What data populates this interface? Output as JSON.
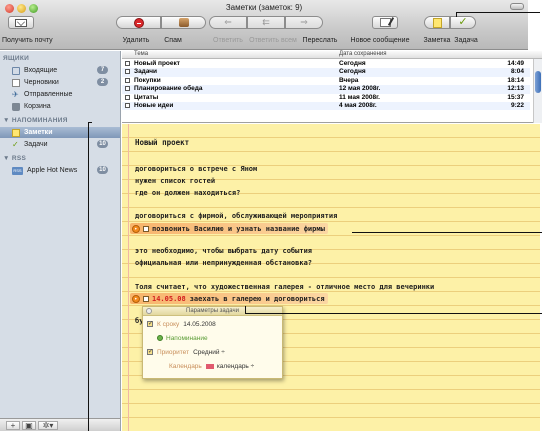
{
  "window": {
    "title": "Заметки (заметок: 9)"
  },
  "toolbar": {
    "get_mail": "Получить почту",
    "delete": "Удалить",
    "junk": "Спам",
    "reply": "Ответить",
    "reply_all": "Ответить всем",
    "forward": "Переслать",
    "new_message": "Новое сообщение",
    "note": "Заметка",
    "task": "Задача"
  },
  "sidebar": {
    "mailboxes_header": "ЯЩИКИ",
    "mailboxes": [
      {
        "label": "Входящие",
        "badge": "7",
        "icon": "inbox-icon"
      },
      {
        "label": "Черновики",
        "badge": "2",
        "icon": "drafts-icon"
      },
      {
        "label": "Отправленные",
        "badge": "",
        "icon": "sent-icon"
      },
      {
        "label": "Корзина",
        "badge": "",
        "icon": "trash-icon"
      }
    ],
    "reminders_header": "▼ НАПОМИНАНИЯ",
    "reminders": [
      {
        "label": "Заметки",
        "badge": "",
        "icon": "notes-icon",
        "selected": true
      },
      {
        "label": "Задачи",
        "badge": "10",
        "icon": "tasks-icon",
        "selected": false
      }
    ],
    "rss_header": "▼ RSS",
    "rss": [
      {
        "label": "Apple Hot News",
        "badge": "10",
        "icon": "rss-icon"
      }
    ]
  },
  "message_list": {
    "columns": {
      "subject": "Тема",
      "date": "Дата сохранения"
    },
    "rows": [
      {
        "subject": "Новый проект",
        "date": "Сегодня",
        "time": "14:49"
      },
      {
        "subject": "Задачи",
        "date": "Сегодня",
        "time": "8:04"
      },
      {
        "subject": "Покупки",
        "date": "Вчера",
        "time": "18:14"
      },
      {
        "subject": "Планирование обеда",
        "date": "12 мая 2008г.",
        "time": "12:13"
      },
      {
        "subject": "Цитаты",
        "date": "11 мая 2008г.",
        "time": "15:37"
      },
      {
        "subject": "Новые идеи",
        "date": "4 мая 2008г.",
        "time": "9:22"
      }
    ]
  },
  "note": {
    "title": "Новый проект",
    "lines": [
      "договориться о встрече с Яном",
      "нужен список гостей",
      "где он должен находиться?",
      "договориться с фирмой, обслуживающей мероприятия",
      "это необходимо, чтобы выбрать дату события",
      "официальная или непринужденная обстановка?",
      "Толя считает, что художественная галерея - отличное место для вечеринки",
      "буд"
    ],
    "todos": [
      {
        "date": "",
        "text": "позвонить Василию и узнать название фирмы"
      },
      {
        "date": "14.05.08",
        "text": "заехать в галерею и договориться"
      }
    ]
  },
  "task_popup": {
    "title": "Параметры задачи",
    "due_label": "К сроку",
    "due_value": "14.05.2008",
    "reminder_label": "Напоминание",
    "priority_label": "Приоритет",
    "priority_value": "Средний ÷",
    "calendar_label": "Календарь",
    "calendar_value": "календарь ÷"
  }
}
